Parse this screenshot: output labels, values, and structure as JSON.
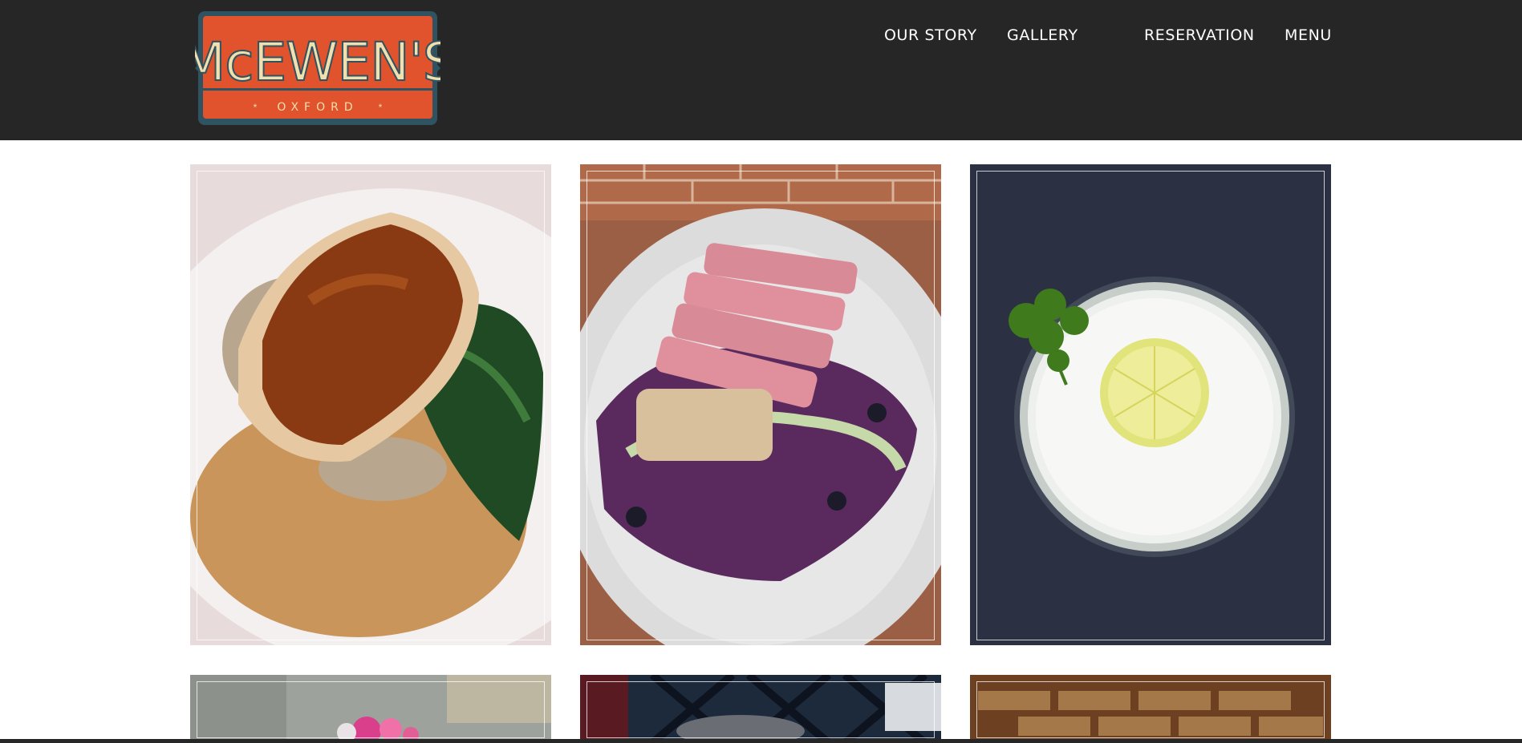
{
  "brand": {
    "name": "McEWEN'S",
    "location": "OXFORD",
    "colors": {
      "header_bg": "#262626",
      "logo_orange": "#e0532c",
      "logo_teal": "#2f5360",
      "logo_cream": "#f1dfae"
    }
  },
  "nav": {
    "items": [
      {
        "label": "OUR STORY"
      },
      {
        "label": "GALLERY"
      },
      {
        "label": "RESERVATION"
      },
      {
        "label": "MENU"
      }
    ]
  },
  "gallery": {
    "photos": [
      {
        "subject": "glazed fish over risotto with spinach"
      },
      {
        "subject": "seared sesame tuna over cabbage slaw"
      },
      {
        "subject": "frothy cocktail with lemon slice and parsley"
      },
      {
        "subject": "pink flowers in window"
      },
      {
        "subject": "dining table and chairs"
      },
      {
        "subject": "brick wall"
      }
    ]
  }
}
